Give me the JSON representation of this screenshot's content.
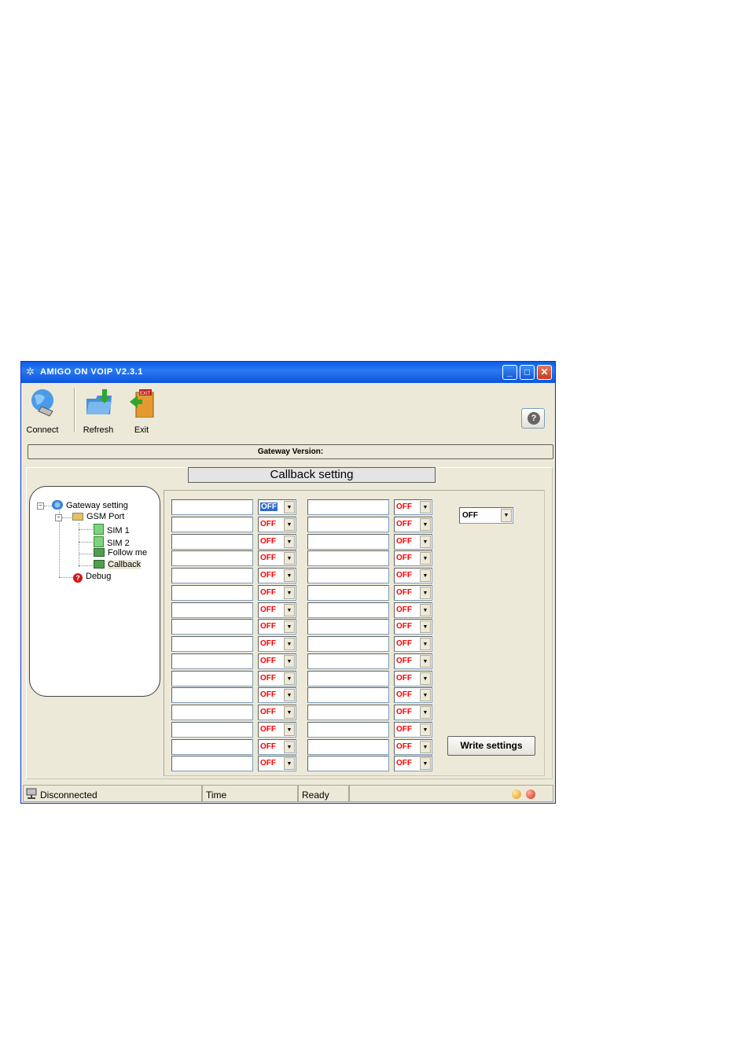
{
  "window": {
    "title": "AMIGO ON VOIP V2.3.1"
  },
  "toolbar": {
    "connect_label": "Connect",
    "refresh_label": "Refresh",
    "exit_label": "Exit",
    "exit_sign_text": "EXIT",
    "help_icon": "?"
  },
  "gateway_version_label": "Gateway Version:",
  "section_title": "Callback setting",
  "tree": {
    "root": "Gateway setting",
    "gsm_port": "GSM Port",
    "sim1": "SIM 1",
    "sim2": "SIM 2",
    "follow_me": "Follow me",
    "callback": "Callback",
    "debug": "Debug"
  },
  "grid": {
    "rows": 16,
    "combo_value": "OFF",
    "selected_combo": {
      "row": 0,
      "col": 0
    }
  },
  "right_combo_value": "OFF",
  "write_button": "Write settings",
  "status": {
    "connection": "Disconnected",
    "time": "Time",
    "state": "Ready"
  },
  "colors": {
    "off_text": "#ff0000",
    "title_bar": "#0a5ee8",
    "selection": "#316ac5"
  }
}
